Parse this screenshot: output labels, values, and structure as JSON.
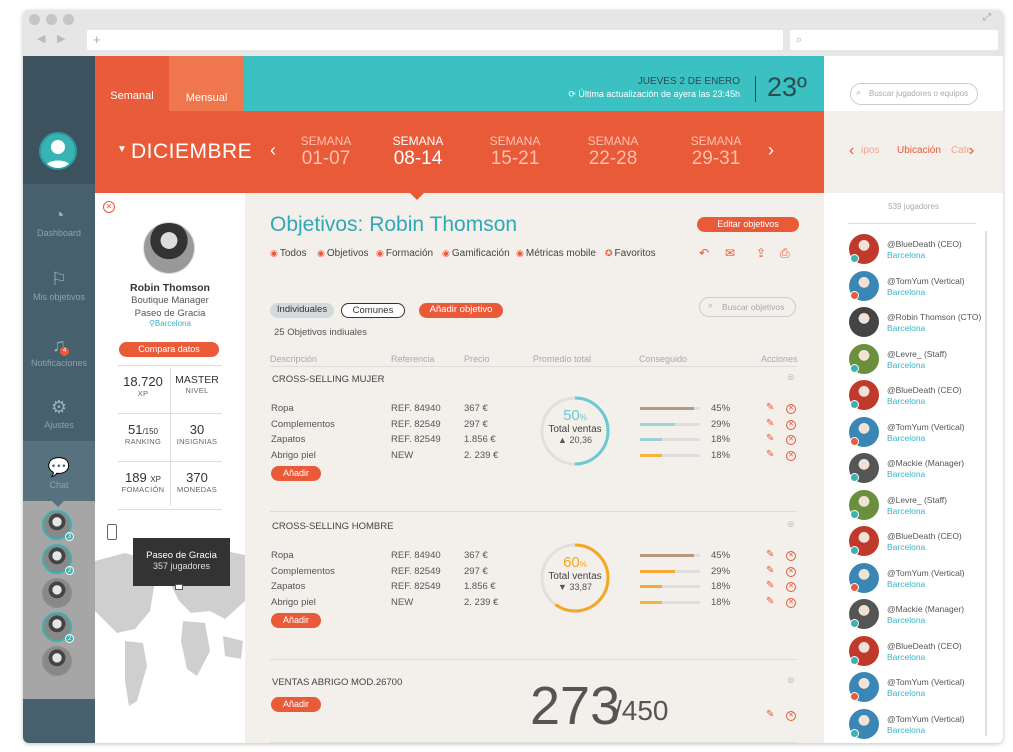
{
  "browser": {
    "url_icon": "+",
    "search_icon": "search-icon"
  },
  "tabs": {
    "semanal": "Semanal",
    "mensual": "Mensual"
  },
  "header": {
    "date": "JUEVES 2 DE ENERO",
    "update": "Última actualización de ayera las 23:45h",
    "temperature": "23º"
  },
  "calendar": {
    "month": "DICIEMBRE",
    "weeks": [
      {
        "label": "SEMANA",
        "range": "01-07"
      },
      {
        "label": "SEMANA",
        "range": "08-14"
      },
      {
        "label": "SEMANA",
        "range": "15-21"
      },
      {
        "label": "SEMANA",
        "range": "22-28"
      },
      {
        "label": "SEMANA",
        "range": "29-31"
      }
    ]
  },
  "sidebar": {
    "items": [
      {
        "label": "Dashboard",
        "icon": "gauge-icon"
      },
      {
        "label": "Mis objetivos",
        "icon": "flag-icon"
      },
      {
        "label": "Notificaciones",
        "icon": "bell-icon",
        "badge": "4"
      },
      {
        "label": "Ajustes",
        "icon": "gear-icon"
      },
      {
        "label": "Chat",
        "icon": "chat-icon"
      }
    ],
    "avatar_badges": [
      "3",
      "2",
      "",
      "2",
      ""
    ]
  },
  "profile": {
    "name": "Robin Thomson",
    "role": "Boutique Manager",
    "store": "Paseo de Gracia",
    "city": "Barcelona",
    "compare_button": "Compara datos",
    "stats": [
      {
        "value": "18.720",
        "label": "XP"
      },
      {
        "value": "MASTER",
        "label": "NIVEL"
      },
      {
        "value": "51",
        "unit": "/150",
        "label": "RANKING"
      },
      {
        "value": "30",
        "label": "INSIGNIAS"
      },
      {
        "value": "189",
        "unit": "XP",
        "label": "FOMACIÓN"
      },
      {
        "value": "370",
        "label": "MONEDAS"
      }
    ],
    "map_tooltip": {
      "title": "Paseo de Gracia",
      "sub": "357 jugadores"
    }
  },
  "main": {
    "title": "Objetivos: Robin Thomson",
    "edit_button": "Editar objetivos",
    "filters": [
      "Todos",
      "Objetivos",
      "Formación",
      "Gamificación",
      "Métricas mobile",
      "Favoritos"
    ],
    "chips": {
      "individual": "Individuales",
      "common": "Comunes",
      "add": "Añadir objetivo"
    },
    "search_placeholder": "Buscar objetivos",
    "count_text": "25 Objetivos indiuales",
    "columns": [
      "Descripción",
      "Referencia",
      "Precio",
      "Promedio total",
      "Conseguido",
      "Acciones"
    ],
    "add_label": "Añadir",
    "sections": [
      {
        "title": "CROSS-SELLING MUJER",
        "rows": [
          {
            "desc": "Ropa",
            "ref": "REF. 84940",
            "price": "367 €",
            "pct": "45%",
            "value": 0.45,
            "color": "#b39a7c"
          },
          {
            "desc": "Complementos",
            "ref": "REF. 82549",
            "price": "297 €",
            "pct": "29%",
            "value": 0.29,
            "color": "#9fd4d4"
          },
          {
            "desc": "Zapatos",
            "ref": "REF. 82549",
            "price": "1.856 €",
            "pct": "18%",
            "value": 0.18,
            "color": "#9ecfd6"
          },
          {
            "desc": "Abrigo piel",
            "ref": "NEW",
            "price": "2. 239 €",
            "pct": "18%",
            "value": 0.18,
            "color": "#f5b53c"
          }
        ],
        "ring": {
          "percent": "50",
          "percent_sign": "%",
          "label": "Total ventas",
          "delta": "▲ 20,36",
          "value": 0.5,
          "color": "#6cc9d3"
        }
      },
      {
        "title": "CROSS-SELLING HOMBRE",
        "rows": [
          {
            "desc": "Ropa",
            "ref": "REF. 84940",
            "price": "367 €",
            "pct": "45%",
            "value": 0.45,
            "color": "#b39a7c"
          },
          {
            "desc": "Complementos",
            "ref": "REF. 82549",
            "price": "297 €",
            "pct": "29%",
            "value": 0.29,
            "color": "#f5a833"
          },
          {
            "desc": "Zapatos",
            "ref": "REF. 82549",
            "price": "1.856 €",
            "pct": "18%",
            "value": 0.18,
            "color": "#f5a833"
          },
          {
            "desc": "Abrigo piel",
            "ref": "NEW",
            "price": "2. 239 €",
            "pct": "18%",
            "value": 0.18,
            "color": "#f5b53c"
          }
        ],
        "ring": {
          "percent": "60",
          "percent_sign": "%",
          "label": "Total ventas",
          "delta": "▼ 33,87",
          "value": 0.6,
          "color": "#f5a623"
        }
      },
      {
        "title": "VENTAS ABRIGO MOD.26700",
        "big_value": "273",
        "big_total": "/450"
      }
    ]
  },
  "right_panel": {
    "search_placeholder": "Buscar jugadores o equipos",
    "tabs": [
      "ipos",
      "Ubicación",
      "Cate"
    ],
    "count": "539 jugadores",
    "players": [
      {
        "name": "@BlueDeath (CEO)",
        "city": "Barcelona",
        "av": "#c0392b",
        "badge": "#3cb1b1"
      },
      {
        "name": "@TomYum (Vertical)",
        "city": "Barcelona",
        "av": "#3a87b5",
        "badge": "#e95a39"
      },
      {
        "name": "@Robin Thomson (CTO)",
        "city": "Barcelona",
        "av": "#444444",
        "badge": ""
      },
      {
        "name": "@Levre_ (Staff)",
        "city": "Barcelona",
        "av": "#6b8f3c",
        "badge": "#3cb1b1"
      },
      {
        "name": "@BlueDeath (CEO)",
        "city": "Barcelona",
        "av": "#c0392b",
        "badge": "#3cb1b1"
      },
      {
        "name": "@TomYum (Vertical)",
        "city": "Barcelona",
        "av": "#3a87b5",
        "badge": "#e95a39"
      },
      {
        "name": "@Mackie (Manager)",
        "city": "Barcelona",
        "av": "#555555",
        "badge": "#3cb1b1"
      },
      {
        "name": "@Levre_ (Staff)",
        "city": "Barcelona",
        "av": "#6b8f3c",
        "badge": "#3cb1b1"
      },
      {
        "name": "@BlueDeath (CEO)",
        "city": "Barcelona",
        "av": "#c0392b",
        "badge": "#3cb1b1"
      },
      {
        "name": "@TomYum (Vertical)",
        "city": "Barcelona",
        "av": "#3a87b5",
        "badge": "#e95a39"
      },
      {
        "name": "@Mackie (Manager)",
        "city": "Barcelona",
        "av": "#555555",
        "badge": "#3cb1b1"
      },
      {
        "name": "@BlueDeath (CEO)",
        "city": "Barcelona",
        "av": "#c0392b",
        "badge": "#3cb1b1"
      },
      {
        "name": "@TomYum (Vertical)",
        "city": "Barcelona",
        "av": "#3a87b5",
        "badge": "#e95a39"
      },
      {
        "name": "@TomYum (Vertical)",
        "city": "Barcelona",
        "av": "#3a87b5",
        "badge": "#3cb1b1"
      }
    ]
  },
  "colors": {
    "accent": "#e95a39",
    "teal": "#3bc1c1",
    "sidebar": "#46606d",
    "link": "#39b4c6"
  }
}
